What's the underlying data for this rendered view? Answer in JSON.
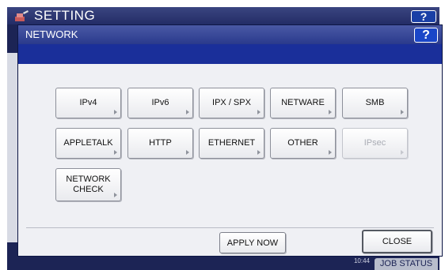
{
  "background": {
    "title": "SETTING",
    "help_label": "?",
    "clock": [
      "",
      "10:44"
    ],
    "job_status_label": "JOB STATUS"
  },
  "dialog": {
    "title": "NETWORK",
    "help_label": "?"
  },
  "buttons": [
    {
      "label": "IPv4",
      "enabled": true
    },
    {
      "label": "IPv6",
      "enabled": true
    },
    {
      "label": "IPX / SPX",
      "enabled": true
    },
    {
      "label": "NETWARE",
      "enabled": true
    },
    {
      "label": "SMB",
      "enabled": true
    },
    {
      "label": "APPLETALK",
      "enabled": true
    },
    {
      "label": "HTTP",
      "enabled": true
    },
    {
      "label": "ETHERNET",
      "enabled": true
    },
    {
      "label": "OTHER",
      "enabled": true
    },
    {
      "label": "IPsec",
      "enabled": false
    },
    {
      "label_line1": "NETWORK",
      "label_line2": "CHECK",
      "enabled": true
    }
  ],
  "actions": {
    "apply_now_label": "APPLY NOW",
    "close_label": "CLOSE"
  }
}
